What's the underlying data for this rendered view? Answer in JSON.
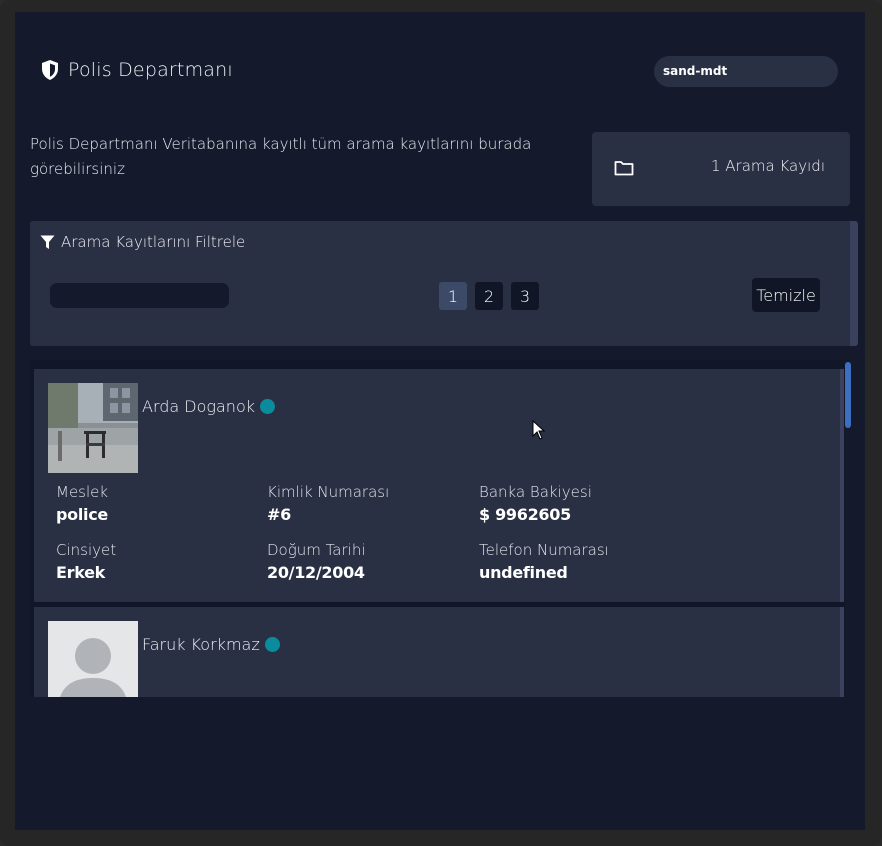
{
  "header": {
    "title": "Polis Departmanı",
    "user": "sand-mdt"
  },
  "intro": {
    "description": "Polis Departmanı Veritabanına kayıtlı tüm arama kayıtlarını burada görebilirsiniz",
    "count_label": "1 Arama Kayıdı"
  },
  "filter": {
    "title": "Arama Kayıtlarını Filtrele",
    "input_value": "",
    "pages": [
      "1",
      "2",
      "3"
    ],
    "active_page": "1",
    "clear_label": "Temizle"
  },
  "records": [
    {
      "name": "Arda Doganok",
      "status": "online",
      "fields": {
        "meslek": {
          "label": "Meslek",
          "value": "police"
        },
        "kimlik": {
          "label": "Kimlik Numarası",
          "value": "#6"
        },
        "banka": {
          "label": "Banka Bakiyesi",
          "value": "$ 9962605"
        },
        "cinsiyet": {
          "label": "Cinsiyet",
          "value": "Erkek"
        },
        "dogum": {
          "label": "Doğum Tarihi",
          "value": "20/12/2004"
        },
        "telefon": {
          "label": "Telefon Numarası",
          "value": "undefined"
        }
      }
    },
    {
      "name": "Faruk Korkmaz",
      "status": "online"
    }
  ],
  "colors": {
    "background": "#141a2c",
    "card": "#2a3044",
    "status_online": "#0b8c9c",
    "active_page": "#3c4a68",
    "scroll_thumb": "#3c6fbf"
  },
  "icons": [
    "shield-icon",
    "folder-icon",
    "filter-icon",
    "mouse-cursor-icon"
  ]
}
